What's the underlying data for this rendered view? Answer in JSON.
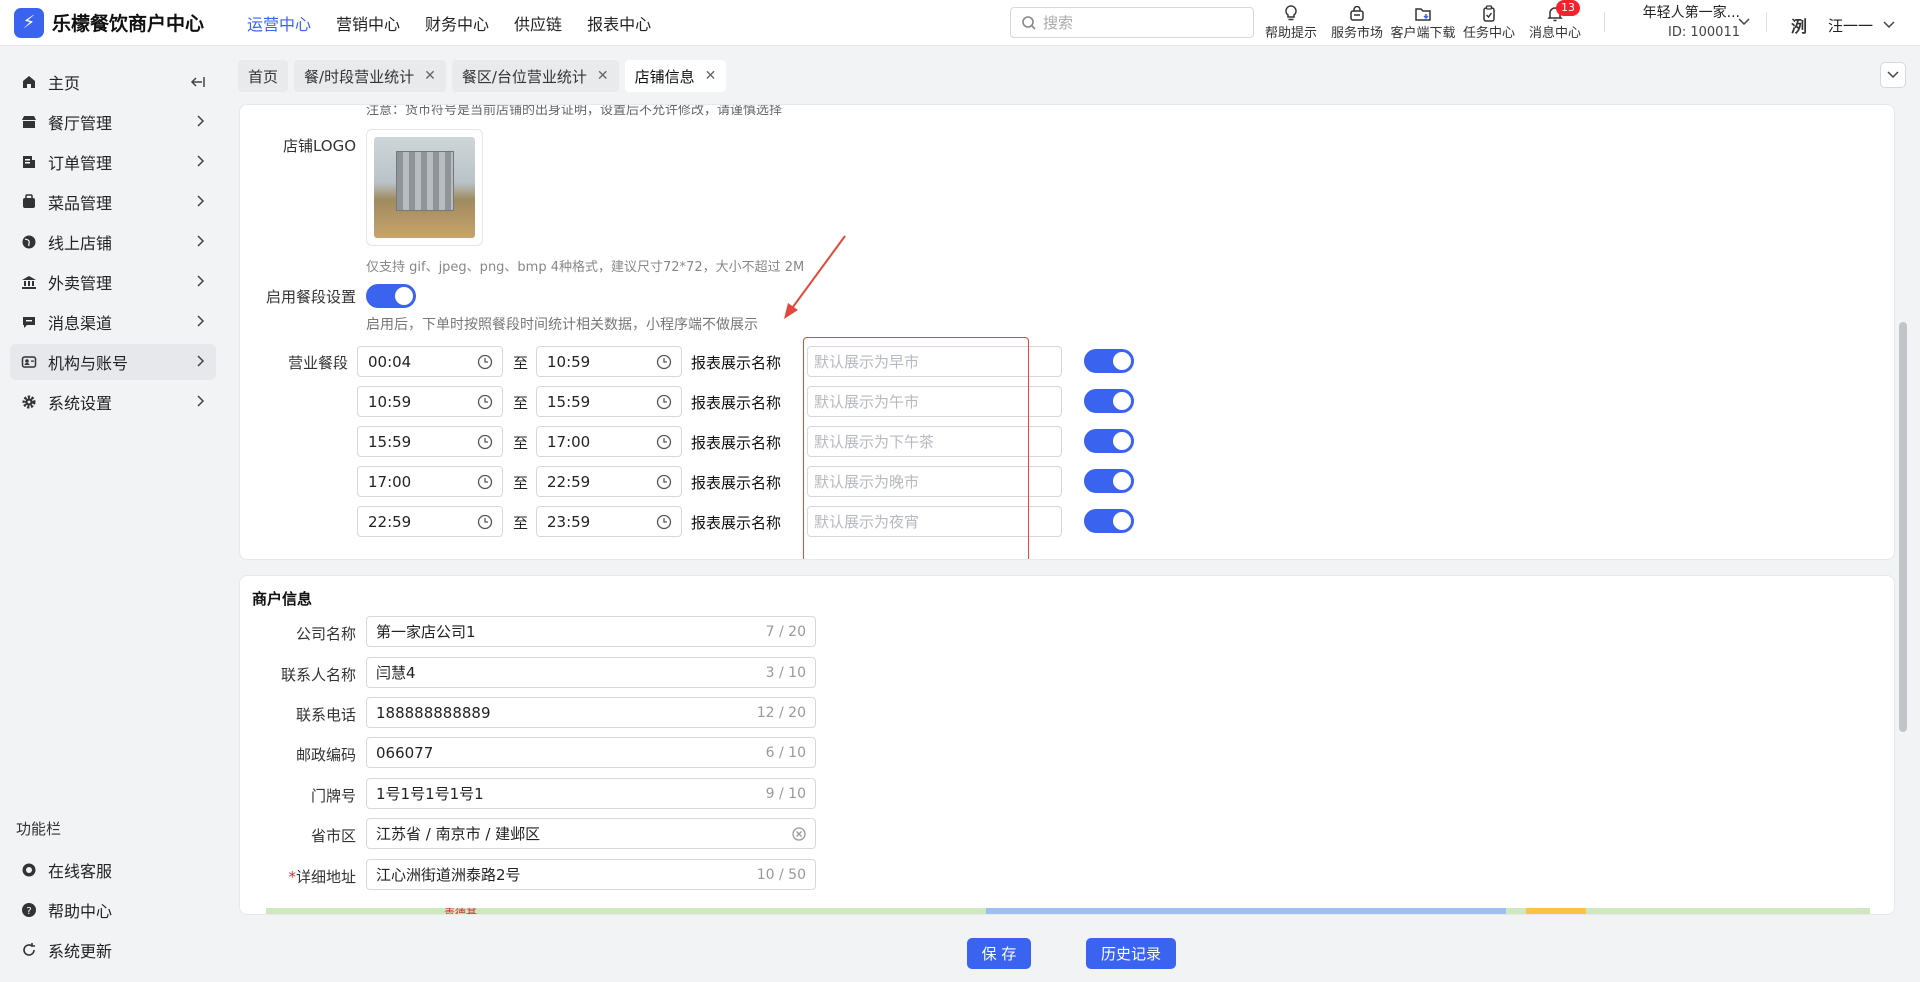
{
  "brand": {
    "name": "乐檬餐饮商户中心",
    "logo_glyph": "⚡"
  },
  "topnav": [
    "运营中心",
    "营销中心",
    "财务中心",
    "供应链",
    "报表中心"
  ],
  "search": {
    "placeholder": "搜索"
  },
  "tools": [
    {
      "label": "帮助提示",
      "icon": "lightbulb-icon"
    },
    {
      "label": "服务市场",
      "icon": "shop-bag-icon"
    },
    {
      "label": "客户端下载",
      "icon": "folder-download-icon"
    },
    {
      "label": "任务中心",
      "icon": "clipboard-icon"
    },
    {
      "label": "消息中心",
      "icon": "bell-icon",
      "badge": "13"
    }
  ],
  "store": {
    "name": "年轻人第一家...",
    "id": "ID: 100011"
  },
  "user": {
    "avatar": "洌",
    "name": "汪一一"
  },
  "sidebar": {
    "items": [
      {
        "label": "主页",
        "icon": "home-icon"
      },
      {
        "label": "餐厅管理",
        "icon": "restaurant-icon"
      },
      {
        "label": "订单管理",
        "icon": "order-icon"
      },
      {
        "label": "菜品管理",
        "icon": "dish-icon"
      },
      {
        "label": "线上店铺",
        "icon": "globe-icon"
      },
      {
        "label": "外卖管理",
        "icon": "bank-icon"
      },
      {
        "label": "消息渠道",
        "icon": "message-icon"
      },
      {
        "label": "机构与账号",
        "icon": "account-icon"
      },
      {
        "label": "系统设置",
        "icon": "gear-icon"
      }
    ],
    "function_title": "功能栏",
    "functions": [
      {
        "label": "在线客服",
        "icon": "support-icon"
      },
      {
        "label": "帮助中心",
        "icon": "help-icon"
      },
      {
        "label": "系统更新",
        "icon": "refresh-icon"
      }
    ]
  },
  "tabs": [
    {
      "label": "首页"
    },
    {
      "label": "餐/时段营业统计"
    },
    {
      "label": "餐区/台位营业统计"
    },
    {
      "label": "店铺信息"
    }
  ],
  "store_section": {
    "cut_note": "注意：货币符号是当前店铺的出身证明，设置后不允许修改，请谨慎选择",
    "logo_label": "店铺LOGO",
    "logo_hint": "仅支持 gif、jpeg、png、bmp 4种格式，建议尺寸72*72，大小不超过 2M",
    "meal_setting_label": "启用餐段设置",
    "meal_setting_on": true,
    "meal_setting_hint": "启用后，下单时按照餐段时间统计相关数据，小程序端不做展示",
    "period_label": "营业餐段",
    "to": "至",
    "report_label": "报表展示名称",
    "periods": [
      {
        "start": "00:04",
        "end": "10:59",
        "placeholder": "默认展示为早市",
        "enabled": true
      },
      {
        "start": "10:59",
        "end": "15:59",
        "placeholder": "默认展示为午市",
        "enabled": true
      },
      {
        "start": "15:59",
        "end": "17:00",
        "placeholder": "默认展示为下午茶",
        "enabled": true
      },
      {
        "start": "17:00",
        "end": "22:59",
        "placeholder": "默认展示为晚市",
        "enabled": true
      },
      {
        "start": "22:59",
        "end": "23:59",
        "placeholder": "默认展示为夜宵",
        "enabled": true
      }
    ]
  },
  "merchant": {
    "title": "商户信息",
    "fields": [
      {
        "label": "公司名称",
        "value": "第一家店公司1",
        "count": "7 / 20"
      },
      {
        "label": "联系人名称",
        "value": "闫慧4",
        "count": "3 / 10"
      },
      {
        "label": "联系电话",
        "value": "188888888889",
        "count": "12 / 20"
      },
      {
        "label": "邮政编码",
        "value": "066077",
        "count": "6 / 10"
      },
      {
        "label": "门牌号",
        "value": "1号1号1号1号1",
        "count": "9 / 10"
      },
      {
        "label": "省市区",
        "value": "江苏省 / 南京市 / 建邺区",
        "count": ""
      },
      {
        "label": "详细地址",
        "value": "江心洲街道洲泰路2号",
        "count": "10 / 50",
        "required": true
      }
    ],
    "map_label": "青德基"
  },
  "footer": {
    "save": "保 存",
    "history": "历史记录"
  },
  "colors": {
    "accent": "#3a63f0",
    "annotation": "#e04a3c",
    "badge": "#f5222d"
  }
}
